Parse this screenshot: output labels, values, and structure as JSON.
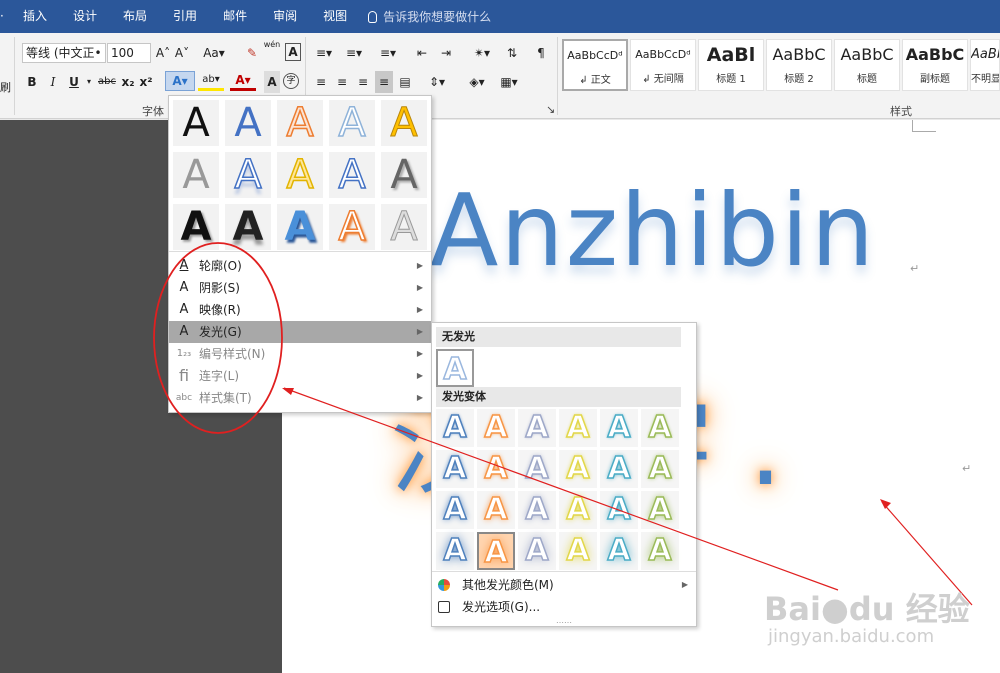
{
  "menubar": {
    "first": "·",
    "tabs": [
      "插入",
      "设计",
      "布局",
      "引用",
      "邮件",
      "审阅",
      "视图"
    ],
    "tell_me": "告诉我你想要做什么"
  },
  "ribbon": {
    "font_name": "等线 (中文正•",
    "font_size": "100",
    "grow": "A˄",
    "shrink": "A˅",
    "change_case": "Aa▾",
    "wen": "wén",
    "bold": "B",
    "italic": "I",
    "underline": "U",
    "strike": "abc",
    "subscript": "x₂",
    "superscript": "x²",
    "font_color": "A",
    "font_group_label": "字体",
    "paragraph_group_label": "↘",
    "styles_group_label": "样式",
    "left_edge_label": "刷",
    "styles": [
      {
        "sample": "AaBbCcDᵈ",
        "label": "↲ 正文"
      },
      {
        "sample": "AaBbCcDᵈ",
        "label": "↲ 无间隔"
      },
      {
        "sample": "AaBl",
        "label": "标题 1"
      },
      {
        "sample": "AaBbC",
        "label": "标题 2"
      },
      {
        "sample": "AaBbC",
        "label": "标题"
      },
      {
        "sample": "AaBbC",
        "label": "副标题"
      },
      {
        "sample": "AaBb",
        "label": "不明显"
      }
    ]
  },
  "document": {
    "line1": "Anzhibin",
    "line2": "汉文字 .",
    "para_mark": "↵"
  },
  "effects_menu": {
    "tile_letter": "A",
    "items": [
      {
        "label": "轮廓(O)",
        "icon": "A"
      },
      {
        "label": "阴影(S)",
        "icon": "A"
      },
      {
        "label": "映像(R)",
        "icon": "A"
      },
      {
        "label": "发光(G)",
        "icon": "A"
      },
      {
        "label": "编号样式(N)",
        "icon": "1₂₃"
      },
      {
        "label": "连字(L)",
        "icon": "fi"
      },
      {
        "label": "样式集(T)",
        "icon": "abc"
      }
    ]
  },
  "glow_submenu": {
    "no_glow_header": "无发光",
    "variants_header": "发光变体",
    "tile_letter": "A",
    "more_colors": "其他发光颜色(M)",
    "options": "发光选项(G)...",
    "grip": "……",
    "variant_colors": [
      "#4f81bd",
      "#f79646",
      "#9ea8c8",
      "#e2d74a",
      "#4bacc6",
      "#9bbb59"
    ]
  },
  "watermark": {
    "brand": "Bai●du 经验",
    "url": "jingyan.baidu.com"
  }
}
